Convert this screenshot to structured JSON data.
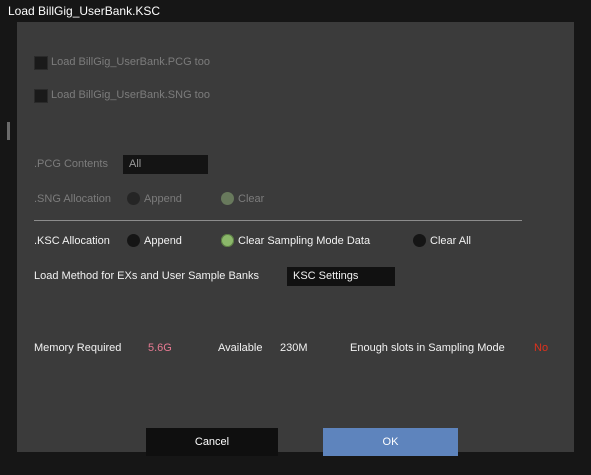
{
  "window": {
    "title": "Load BillGig_UserBank.KSC"
  },
  "options": {
    "load_pcg_too": {
      "label": "Load BillGig_UserBank.PCG too",
      "checked": false,
      "enabled": false
    },
    "load_sng_too": {
      "label": "Load BillGig_UserBank.SNG too",
      "checked": false,
      "enabled": false
    }
  },
  "pcg_contents": {
    "label": ".PCG Contents",
    "value": "All",
    "enabled": false
  },
  "sng_allocation": {
    "label": ".SNG Allocation",
    "options": [
      "Append",
      "Clear"
    ],
    "selected": "Clear",
    "enabled": false
  },
  "ksc_allocation": {
    "label": ".KSC Allocation",
    "options": [
      "Append",
      "Clear Sampling Mode Data",
      "Clear All"
    ],
    "selected": "Clear Sampling Mode Data"
  },
  "load_method": {
    "label": "Load Method for EXs and User Sample Banks",
    "value": "KSC Settings"
  },
  "memory": {
    "required_label": "Memory Required",
    "required_value": "5.6G",
    "available_label": "Available",
    "available_value": "230M",
    "slots_label": "Enough slots in Sampling Mode",
    "slots_value": "No"
  },
  "buttons": {
    "cancel": "Cancel",
    "ok": "OK"
  },
  "colors": {
    "accent_ok": "#5e84bd",
    "radio_selected": "#8bb86a",
    "warning": "#e0311c",
    "memory_value": "#e77a92"
  }
}
